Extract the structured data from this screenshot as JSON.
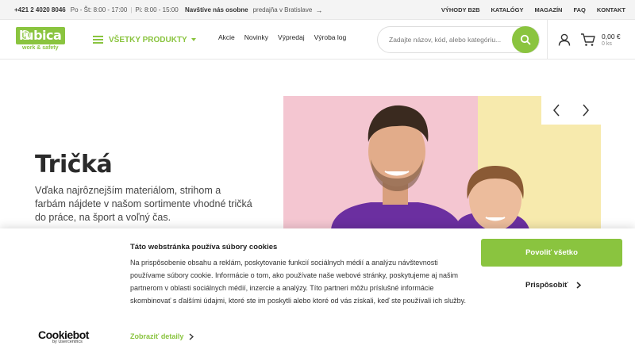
{
  "topbar": {
    "phone": "+421 2 4020 8046",
    "hours_weekday": "Po - Št: 8:00 - 17:00",
    "separator": "|",
    "hours_friday": "Pi: 8:00 - 15:00",
    "visit_label": "Navštíve nás osobne",
    "visit_shop": "predajňa v Bratislave",
    "links": [
      "VÝHODY B2B",
      "KATALÓGY",
      "MAGAZÍN",
      "FAQ",
      "KONTAKT"
    ]
  },
  "header": {
    "logo_text": "ľubica",
    "logo_reg": "®",
    "logo_sub": "work & safety",
    "all_products": "VŠETKY PRODUKTY",
    "nav": [
      "Akcie",
      "Novinky",
      "Výpredaj",
      "Výroba log"
    ],
    "search_placeholder": "Zadajte názov, kód, alebo kategóriu...",
    "cart_price": "0,00 €",
    "cart_count": "0 ks"
  },
  "hero": {
    "title": "Tričká",
    "text": "Vďaka najrôznejším materiálom, strihom a farbám nájdete v našom sortimente vhodné tričká do práce, na šport a voľný čas."
  },
  "cookie": {
    "title": "Táto webstránka používa súbory cookies",
    "body": "Na prispôsobenie obsahu a reklám, poskytovanie funkcií sociálnych médií a analýzu návštevnosti používame súbory cookie. Informácie o tom, ako používate naše webové stránky, poskytujeme aj našim partnerom v oblasti sociálnych médií, inzercie a analýzy. Títo partneri môžu príslušné informácie skombinovať s ďalšími údajmi, ktoré ste im poskytli alebo ktoré od vás získali, keď ste používali ich služby.",
    "brand": "Cookiebot",
    "brand_by": "by Usercentrics",
    "details_label": "Zobraziť detaily",
    "allow_label": "Povoliť všetko",
    "customize_label": "Prispôsobiť"
  },
  "colors": {
    "accent": "#8ac43f",
    "hero_pink": "#f4c6d1",
    "hero_yellow": "#f7eaad"
  }
}
